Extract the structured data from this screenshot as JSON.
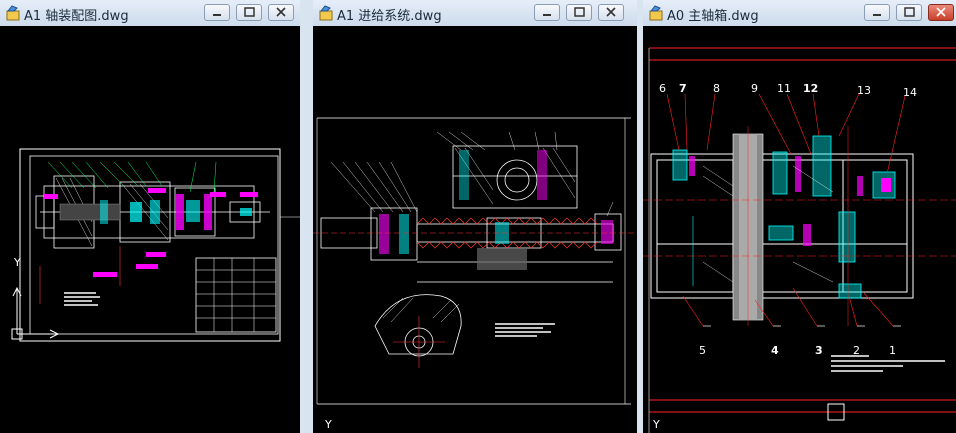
{
  "windows": [
    {
      "title": "A1 轴装配图.dwg",
      "ucs_label": "Y"
    },
    {
      "title": "A1 进给系统.dwg",
      "ucs_label": "Y"
    },
    {
      "title": "A0 主轴箱.dwg",
      "ucs_label": "Y",
      "callouts_top": [
        "6",
        "7",
        "8",
        "9",
        "11",
        "12",
        "13",
        "14"
      ],
      "callouts_bottom": [
        "5",
        "4",
        "3",
        "2",
        "1"
      ]
    }
  ],
  "colors": {
    "canvas": "#000000",
    "title_bar": "#dbe5f2",
    "accent_cyan": "#00ffff",
    "accent_magenta": "#ff00ff",
    "accent_red": "#ff0000"
  }
}
